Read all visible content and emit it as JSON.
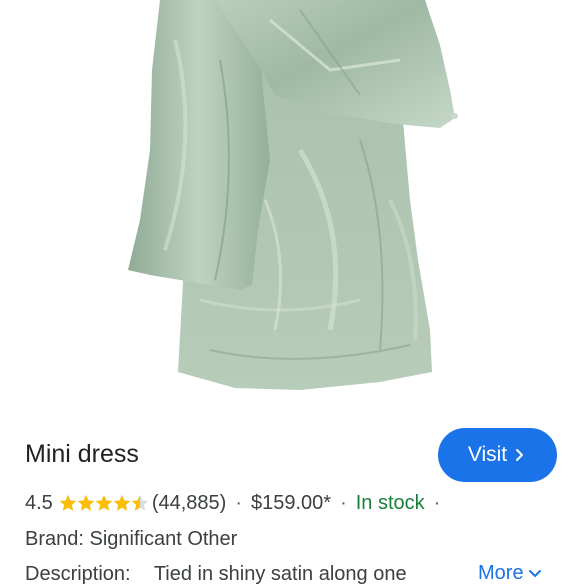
{
  "product": {
    "title": "Mini dress",
    "visit_label": "Visit",
    "rating": "4.5",
    "rating_value": 4.5,
    "reviews": "(44,885)",
    "separator": "·",
    "price": "$159.00*",
    "stock": "In stock",
    "brand": "Brand: Significant Other",
    "description_label": "Description:",
    "description": "Tied in shiny satin along one",
    "more_label": "More"
  },
  "colors": {
    "accent": "#1a73e8",
    "star": "#fbbc04",
    "stock": "#188038",
    "fabric": "#a8c2ad"
  },
  "icons": {
    "visit": "chevron-right-icon",
    "more": "chevron-down-icon",
    "rating": "star-icon"
  }
}
